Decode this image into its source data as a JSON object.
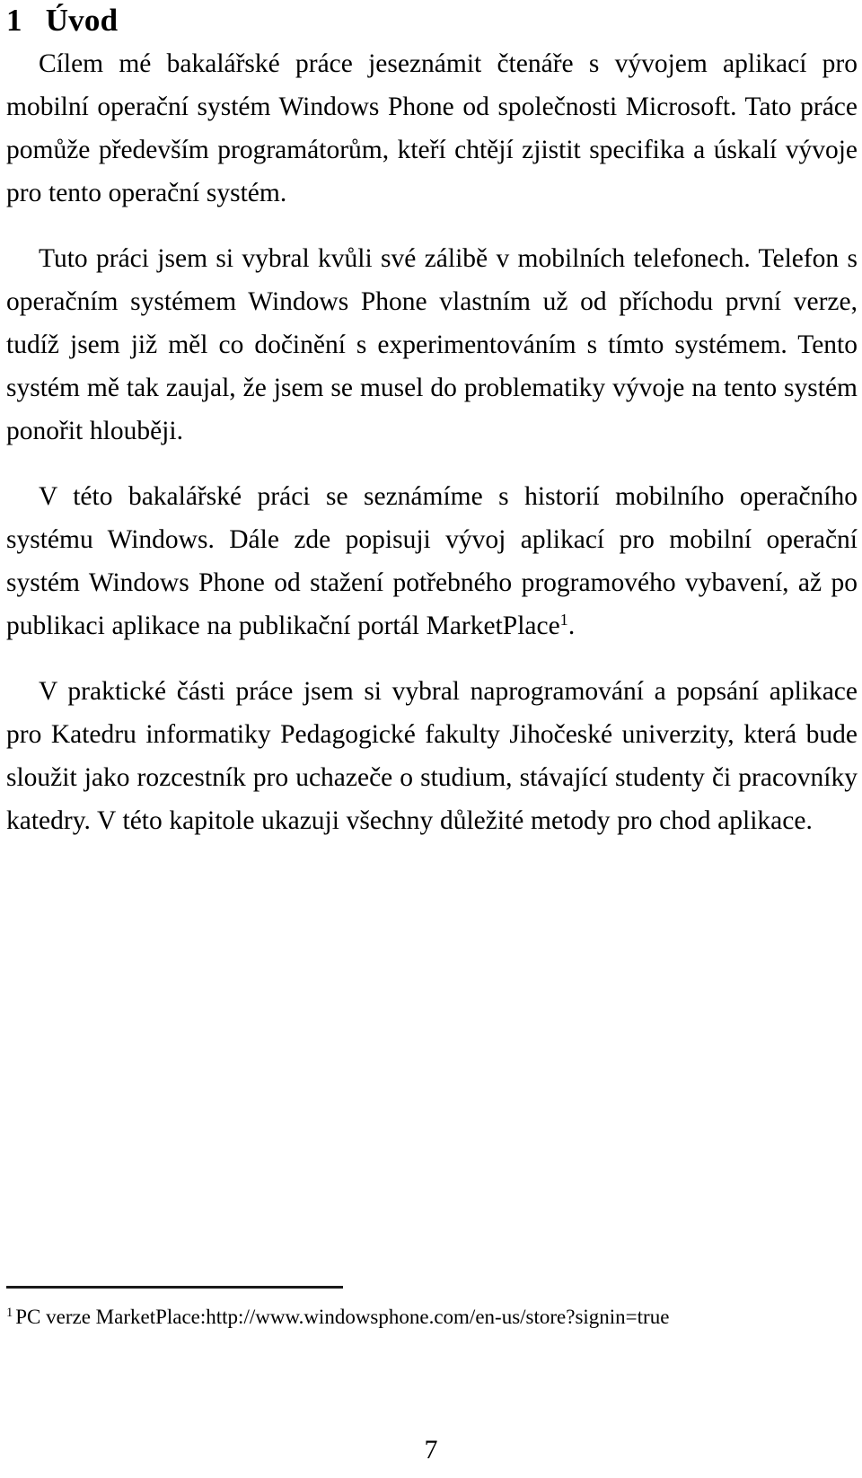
{
  "document": {
    "language": "cs",
    "page_background": "#ffffff",
    "text_color": "#000000"
  },
  "heading": {
    "number": "1",
    "title": "Úvod"
  },
  "paragraphs": [
    {
      "id": "par-1",
      "text": "Cílem mé bakalářské práce jeseznámit čtenáře s vývojem aplikací pro mobilní operační systém Windows Phone od společnosti Microsoft. Tato práce pomůže především programátorům, kteří chtějí zjistit specifika a úskalí vývoje pro tento operační systém."
    },
    {
      "id": "par-2",
      "text": "Tuto práci jsem si vybral kvůli své zálibě v mobilních telefonech. Telefon s operačním systémem Windows Phone vlastním už od příchodu první verze, tudíž jsem již měl co dočinění s experimentováním s tímto systémem. Tento systém mě tak zaujal, že jsem se musel do problematiky vývoje na tento systém ponořit hlouběji."
    },
    {
      "id": "par-3-a",
      "text": "V této bakalářské práci se seznámíme s historií mobilního operačního systému Windows. Dále zde popisuji vývoj aplikací pro mobilní operační systém Windows Phone od stažení potřebného programového vybavení, až po publikaci aplikace na publikační portál MarketPlace",
      "footnote_marker": "1",
      "text_after_marker": "."
    },
    {
      "id": "par-4",
      "text": "V praktické části práce jsem si vybral naprogramování a popsání aplikace pro Katedru informatiky Pedagogické fakulty Jihočeské univerzity, která bude sloužit jako rozcestník pro uchazeče o studium, stávající studenty či pracovníky katedry. V této kapitole ukazuji všechny důležité metody pro chod aplikace."
    }
  ],
  "footnote": {
    "marker": "1",
    "text": "PC verze MarketPlace:http://www.windowsphone.com/en-us/store?signin=true"
  },
  "page_number": "7"
}
